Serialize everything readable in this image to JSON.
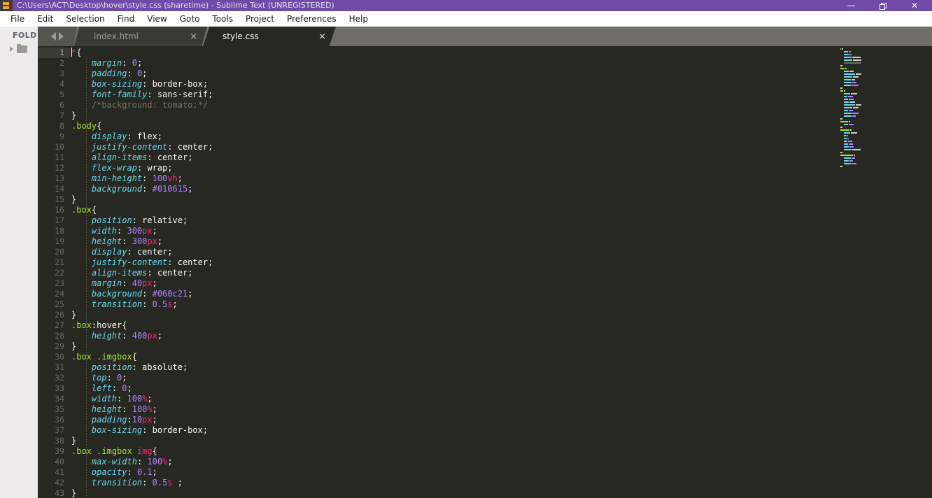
{
  "window": {
    "title": "C:\\Users\\ACT\\Desktop\\hover\\style.css (sharetime) - Sublime Text (UNREGISTERED)",
    "icon_glyph": "S",
    "controls": {
      "minimize": "minimize",
      "restore": "restore",
      "close": "close"
    },
    "accent_color": "#6f4aa8",
    "editor_bg": "#272822"
  },
  "menubar": {
    "items": [
      {
        "label": "File"
      },
      {
        "label": "Edit"
      },
      {
        "label": "Selection"
      },
      {
        "label": "Find"
      },
      {
        "label": "View"
      },
      {
        "label": "Goto"
      },
      {
        "label": "Tools"
      },
      {
        "label": "Project"
      },
      {
        "label": "Preferences"
      },
      {
        "label": "Help"
      }
    ]
  },
  "sidebar": {
    "header": "FOLD",
    "folder_row": {
      "expand_icon": "triangle-right-icon",
      "folder_icon": "folder-icon"
    }
  },
  "tabbar": {
    "nav": {
      "prev_icon": "arrow-left-icon",
      "next_icon": "arrow-right-icon"
    },
    "tabs": [
      {
        "label": "index.html",
        "active": false,
        "close": "×"
      },
      {
        "label": "style.css",
        "active": true,
        "close": "×"
      }
    ]
  },
  "editor": {
    "current_line": 1,
    "first_line": 1,
    "last_visible_line": 43,
    "syntax_colors": {
      "selector": "#a6e22e",
      "tag": "#f92672",
      "property": "#66d9ef",
      "value": "#f8f8f2",
      "number": "#ae81ff",
      "unit": "#f92672",
      "comment": "#75715e",
      "punctuation": "#f8f8f2"
    },
    "lines": [
      {
        "n": 1,
        "text": "*{"
      },
      {
        "n": 2,
        "text": "    margin: 0;"
      },
      {
        "n": 3,
        "text": "    padding: 0;"
      },
      {
        "n": 4,
        "text": "    box-sizing: border-box;"
      },
      {
        "n": 5,
        "text": "    font-family: sans-serif;"
      },
      {
        "n": 6,
        "text": "    /*background: tomato;*/"
      },
      {
        "n": 7,
        "text": "}"
      },
      {
        "n": 8,
        "text": ".body{"
      },
      {
        "n": 9,
        "text": "    display: flex;"
      },
      {
        "n": 10,
        "text": "    justify-content: center;"
      },
      {
        "n": 11,
        "text": "    align-items: center;"
      },
      {
        "n": 12,
        "text": "    flex-wrap: wrap;"
      },
      {
        "n": 13,
        "text": "    min-height: 100vh;"
      },
      {
        "n": 14,
        "text": "    background: #010615;"
      },
      {
        "n": 15,
        "text": "}"
      },
      {
        "n": 16,
        "text": ".box{"
      },
      {
        "n": 17,
        "text": "    position: relative;"
      },
      {
        "n": 18,
        "text": "    width: 300px;"
      },
      {
        "n": 19,
        "text": "    height: 300px;"
      },
      {
        "n": 20,
        "text": "    display: center;"
      },
      {
        "n": 21,
        "text": "    justify-content: center;"
      },
      {
        "n": 22,
        "text": "    align-items: center;"
      },
      {
        "n": 23,
        "text": "    margin: 40px;"
      },
      {
        "n": 24,
        "text": "    background: #060c21;"
      },
      {
        "n": 25,
        "text": "    transition: 0.5s;"
      },
      {
        "n": 26,
        "text": "}"
      },
      {
        "n": 27,
        "text": ".box:hover{"
      },
      {
        "n": 28,
        "text": "    height: 400px;"
      },
      {
        "n": 29,
        "text": "}"
      },
      {
        "n": 30,
        "text": ".box .imgbox{"
      },
      {
        "n": 31,
        "text": "    position: absolute;"
      },
      {
        "n": 32,
        "text": "    top: 0;"
      },
      {
        "n": 33,
        "text": "    left: 0;"
      },
      {
        "n": 34,
        "text": "    width: 100%;"
      },
      {
        "n": 35,
        "text": "    height: 100%;"
      },
      {
        "n": 36,
        "text": "    padding:10px;"
      },
      {
        "n": 37,
        "text": "    box-sizing: border-box;"
      },
      {
        "n": 38,
        "text": "}"
      },
      {
        "n": 39,
        "text": ".box .imgbox img{"
      },
      {
        "n": 40,
        "text": "    max-width: 100%;"
      },
      {
        "n": 41,
        "text": "    opacity: 0.1;"
      },
      {
        "n": 42,
        "text": "    transition: 0.5s ;"
      },
      {
        "n": 43,
        "text": "}"
      }
    ]
  }
}
